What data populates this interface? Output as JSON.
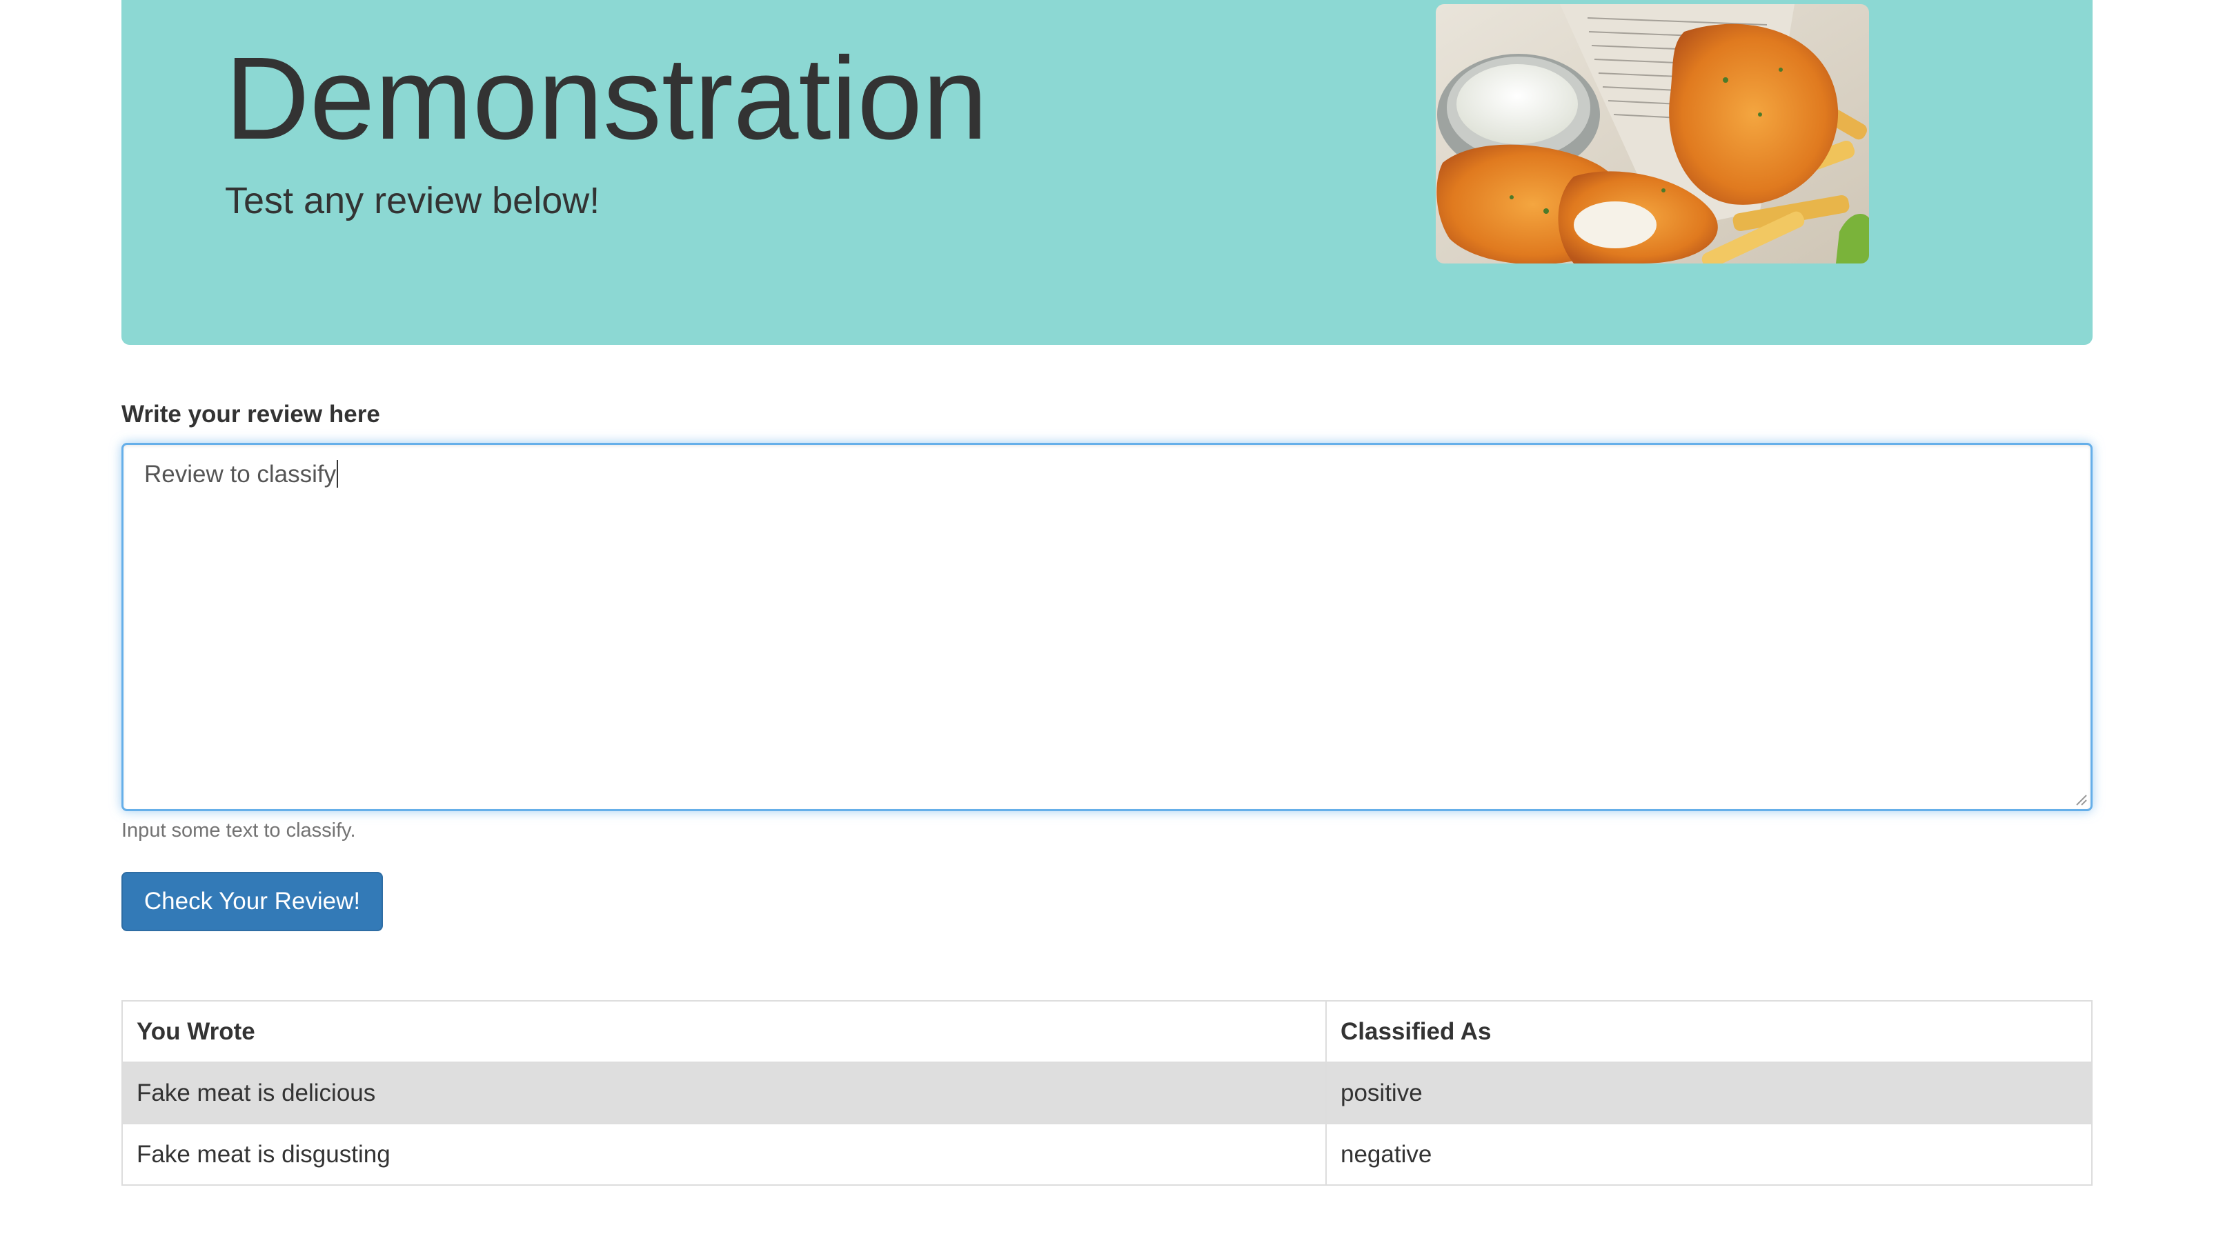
{
  "header": {
    "title": "Demonstration",
    "subtitle": "Test any review below!"
  },
  "hero_image": {
    "alt": "fish-and-chips-photo"
  },
  "form": {
    "label": "Write your review here",
    "textarea_value": "Review to classify",
    "help_text": "Input some text to classify.",
    "submit_label": "Check Your Review!"
  },
  "results": {
    "columns": [
      "You Wrote",
      "Classified As"
    ],
    "rows": [
      {
        "text": "Fake meat is delicious",
        "label": "positive"
      },
      {
        "text": "Fake meat is disgusting",
        "label": "negative"
      }
    ]
  },
  "colors": {
    "jumbotron_bg": "#8cd8d3",
    "button_bg": "#337ab7",
    "focus_border": "#66afe9",
    "striped_row": "#dedede"
  }
}
